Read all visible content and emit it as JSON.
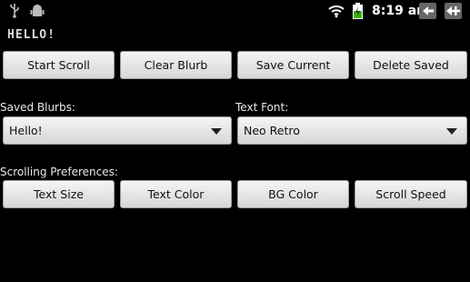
{
  "status": {
    "time": "8:19 am",
    "icons": [
      "usb-icon",
      "android-debug-icon",
      "wifi-icon",
      "battery-charging-icon",
      "back-icon",
      "menu-icon"
    ]
  },
  "marquee_text": "HELLO!",
  "buttons_row1": {
    "start": "Start Scroll",
    "clear": "Clear Blurb",
    "save": "Save Current",
    "delete": "Delete Saved"
  },
  "saved_blurbs": {
    "label": "Saved Blurbs:",
    "value": "Hello!"
  },
  "text_font": {
    "label": "Text Font:",
    "value": "Neo Retro"
  },
  "scrolling": {
    "label": "Scrolling Preferences:",
    "text_size": "Text Size",
    "text_color": "Text Color",
    "bg_color": "BG Color",
    "scroll_speed": "Scroll Speed"
  }
}
